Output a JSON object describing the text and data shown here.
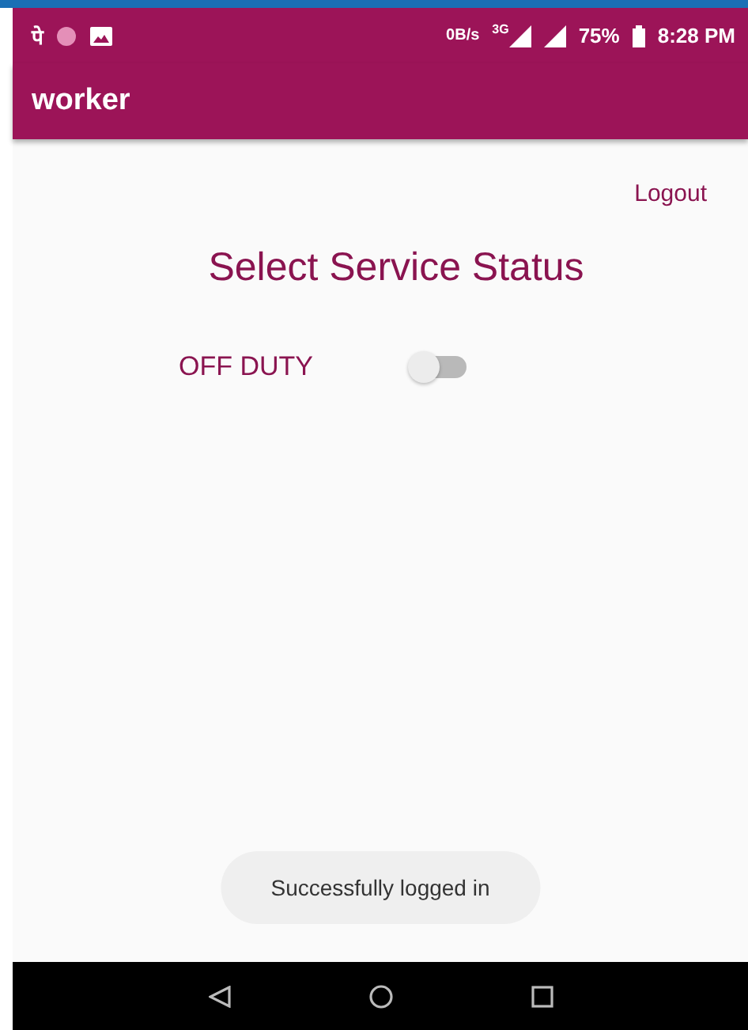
{
  "status_bar": {
    "app_letter": "पे",
    "speed": "0B/s",
    "network": "3G",
    "battery": "75%",
    "time": "8:28 PM"
  },
  "app_bar": {
    "title": "worker"
  },
  "logout": "Logout",
  "heading": "Select Service Status",
  "duty": {
    "label": "OFF DUTY",
    "on": false
  },
  "toast": "Successfully logged in"
}
